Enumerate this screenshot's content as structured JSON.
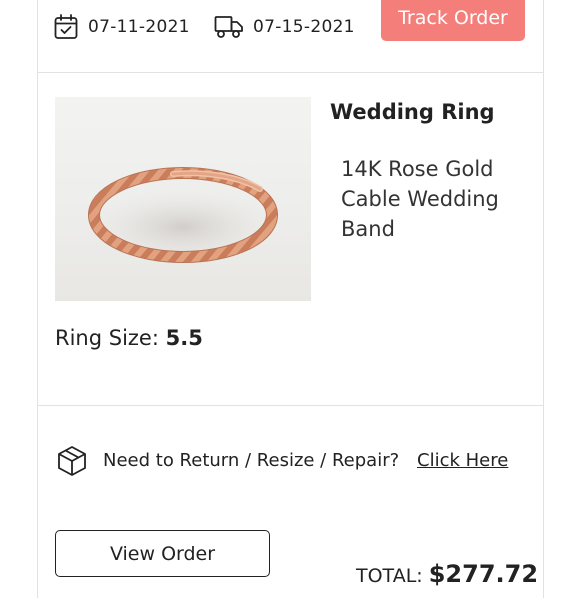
{
  "order": {
    "order_date": "07-11-2021",
    "delivery_date": "07-15-2021",
    "track_label": "Track Order"
  },
  "product": {
    "title": "Wedding Ring",
    "description": "14K Rose Gold Cable Wedding Band",
    "size_label": "Ring Size:",
    "size_value": "5.5"
  },
  "support": {
    "text": "Need to Return / Resize / Repair?",
    "link": "Click Here"
  },
  "footer": {
    "view_label": "View Order",
    "total_label": "TOTAL:",
    "total_value": "$277.72"
  },
  "icons": {
    "order_date": "calendar-check-icon",
    "delivery": "delivery-truck-icon",
    "support": "package-box-icon"
  },
  "colors": {
    "accent": "#f47f7a"
  }
}
